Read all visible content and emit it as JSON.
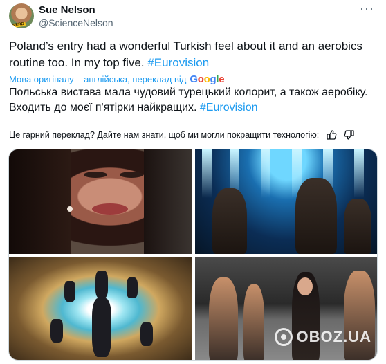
{
  "author": {
    "name": "Sue Nelson",
    "handle": "@ScienceNelson",
    "avatar_badge": "NERD"
  },
  "menu": {
    "more_icon": "more-horizontal-icon",
    "more_glyph": "···"
  },
  "tweet": {
    "text": "Poland’s entry had a wonderful Turkish feel about it and an aerobics routine too. In my top five.",
    "hashtag": "#Eurovision"
  },
  "translation": {
    "source_label": "Мова оригіналу – англійська, переклад від",
    "provider": "Google",
    "text": "Польська вистава мала чудовий турецький колорит, а також аеробіку. Входить до моєї п'ятірки найкращих.",
    "hashtag": "#Eurovision",
    "feedback_prompt": "Це гарний переклад? Дайте нам знати, щоб ми могли покращити технологію:"
  },
  "media": {
    "images": [
      {
        "alt": "photo-1"
      },
      {
        "alt": "photo-2"
      },
      {
        "alt": "photo-3"
      },
      {
        "alt": "photo-4"
      }
    ],
    "watermark": "OBOZ.UA"
  },
  "colors": {
    "accent": "#1d9bf0",
    "text": "#0f1419",
    "muted": "#536471"
  }
}
